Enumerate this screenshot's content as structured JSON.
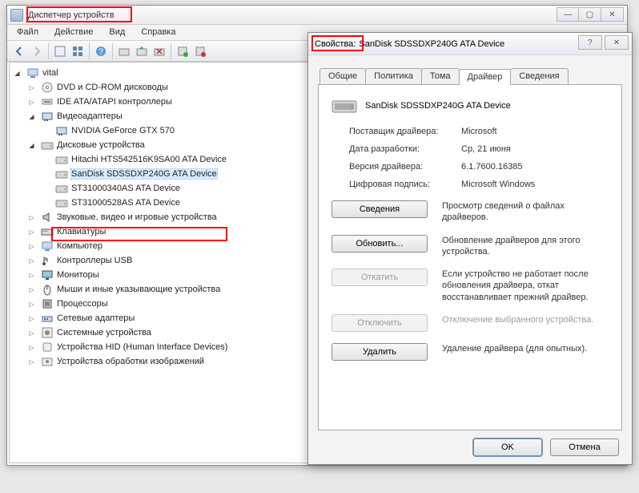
{
  "dm": {
    "title": "Диспетчер устройств",
    "menu": [
      "Файл",
      "Действие",
      "Вид",
      "Справка"
    ],
    "root": "vital",
    "categories": [
      {
        "label": "DVD и CD-ROM дисководы",
        "icon": "cd",
        "state": "closed",
        "children": []
      },
      {
        "label": "IDE ATA/ATAPI контроллеры",
        "icon": "ide",
        "state": "closed",
        "children": []
      },
      {
        "label": "Видеоадаптеры",
        "icon": "gpu",
        "state": "open",
        "children": [
          {
            "label": "NVIDIA GeForce GTX 570",
            "icon": "gpu"
          }
        ]
      },
      {
        "label": "Дисковые устройства",
        "icon": "disk",
        "state": "open",
        "children": [
          {
            "label": "Hitachi HTS542516K9SA00 ATA Device",
            "icon": "disk"
          },
          {
            "label": "SanDisk SDSSDXP240G ATA Device",
            "icon": "disk",
            "selected": true
          },
          {
            "label": "ST31000340AS ATA Device",
            "icon": "disk"
          },
          {
            "label": "ST31000528AS ATA Device",
            "icon": "disk"
          }
        ]
      },
      {
        "label": "Звуковые, видео и игровые устройства",
        "icon": "audio",
        "state": "closed",
        "children": []
      },
      {
        "label": "Клавиатуры",
        "icon": "kb",
        "state": "closed",
        "children": []
      },
      {
        "label": "Компьютер",
        "icon": "computer",
        "state": "closed",
        "children": []
      },
      {
        "label": "Контроллеры USB",
        "icon": "usb",
        "state": "closed",
        "children": []
      },
      {
        "label": "Мониторы",
        "icon": "monitor",
        "state": "closed",
        "children": []
      },
      {
        "label": "Мыши и иные указывающие устройства",
        "icon": "mouse",
        "state": "closed",
        "children": []
      },
      {
        "label": "Процессоры",
        "icon": "cpu",
        "state": "closed",
        "children": []
      },
      {
        "label": "Сетевые адаптеры",
        "icon": "net",
        "state": "closed",
        "children": []
      },
      {
        "label": "Системные устройства",
        "icon": "sys",
        "state": "closed",
        "children": []
      },
      {
        "label": "Устройства HID (Human Interface Devices)",
        "icon": "hid",
        "state": "closed",
        "children": []
      },
      {
        "label": "Устройства обработки изображений",
        "icon": "img",
        "state": "closed",
        "children": []
      }
    ]
  },
  "props": {
    "title_prefix": "Свойства:",
    "title_rest": "SanDisk SDSSDXP240G ATA Device",
    "tabs": [
      "Общие",
      "Политика",
      "Тома",
      "Драйвер",
      "Сведения"
    ],
    "active_tab": 3,
    "device_name": "SanDisk SDSSDXP240G ATA Device",
    "info": {
      "provider_k": "Поставщик драйвера:",
      "provider_v": "Microsoft",
      "date_k": "Дата разработки:",
      "date_v": "Ср, 21 июня",
      "version_k": "Версия драйвера:",
      "version_v": "6.1.7600.16385",
      "sig_k": "Цифровая подпись:",
      "sig_v": "Microsoft Windows"
    },
    "actions": {
      "details_btn": "Сведения",
      "details_desc": "Просмотр сведений о файлах драйверов.",
      "update_btn": "Обновить...",
      "update_desc": "Обновление драйверов для этого устройства.",
      "rollback_btn": "Откатить",
      "rollback_desc": "Если устройство не работает после обновления драйвера, откат восстанавливает прежний драйвер.",
      "disable_btn": "Отключить",
      "disable_desc": "Отключение выбранного устройства.",
      "remove_btn": "Удалить",
      "remove_desc": "Удаление драйвера (для опытных)."
    },
    "ok": "OK",
    "cancel": "Отмена"
  }
}
